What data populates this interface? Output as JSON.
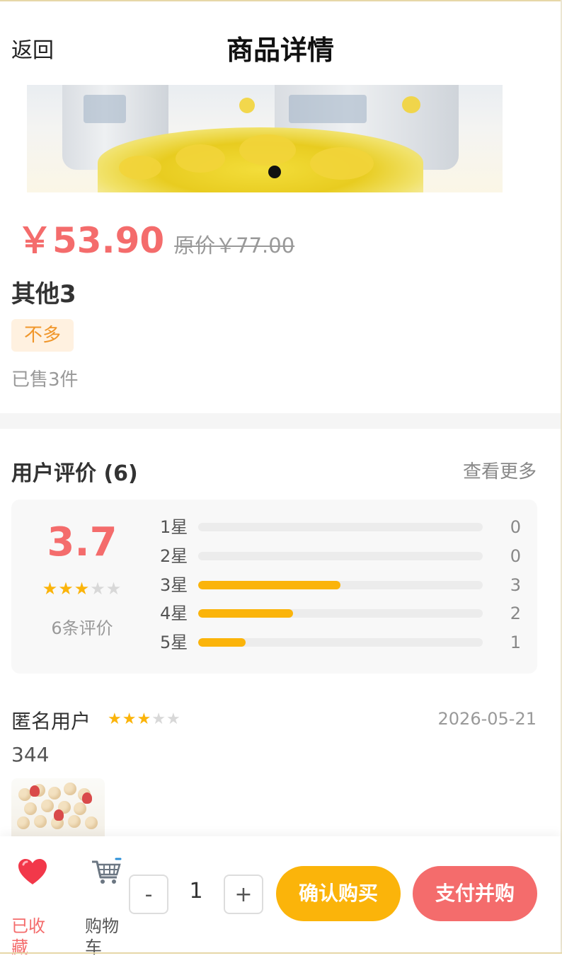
{
  "header": {
    "back_label": "返回",
    "title": "商品详情"
  },
  "banner": {
    "slide_count": 1,
    "active_index": 0
  },
  "product": {
    "price": "￥53.90",
    "original_price": "原价￥77.00",
    "name": "其他3",
    "tag": "不多",
    "sold": "已售3件"
  },
  "reviews": {
    "title": "用户评价 (6)",
    "more_label": "查看更多",
    "average": "3.7",
    "average_stars": 3,
    "max_stars": 5,
    "count_label": "6条评价",
    "distribution": [
      {
        "label": "1星",
        "count": "0",
        "fraction": 0
      },
      {
        "label": "2星",
        "count": "0",
        "fraction": 0
      },
      {
        "label": "3星",
        "count": "3",
        "fraction": 0.5
      },
      {
        "label": "4星",
        "count": "2",
        "fraction": 0.333
      },
      {
        "label": "5星",
        "count": "1",
        "fraction": 0.167
      }
    ],
    "items": [
      {
        "user": "匿名用户",
        "stars": 3,
        "date": "2026-05-21",
        "text": "344"
      }
    ]
  },
  "bottom_bar": {
    "favorite_label": "已收藏",
    "cart_label": "购物车",
    "minus_label": "-",
    "quantity": "1",
    "plus_label": "+",
    "confirm_label": "确认购买",
    "pay_label": "支付并购"
  },
  "colors": {
    "accent_red": "#f46c6c",
    "accent_yellow": "#fbb40a",
    "tag_text": "#f0962a"
  },
  "icons": {
    "favorite": "heart-icon",
    "cart": "shopping-cart-icon",
    "star": "star-icon"
  }
}
